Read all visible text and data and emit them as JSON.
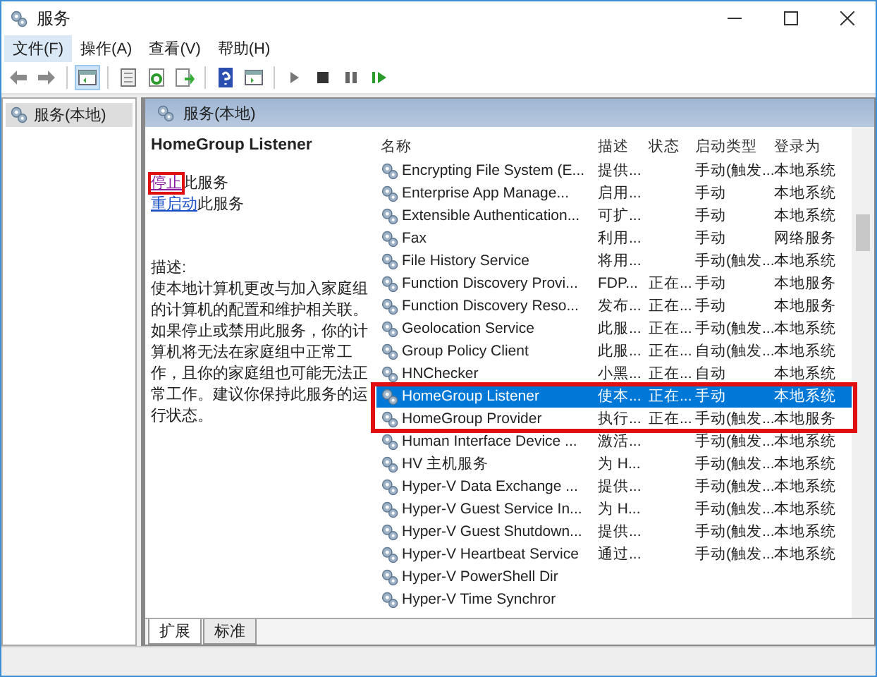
{
  "window": {
    "title": "服务"
  },
  "menu": [
    {
      "label": "文件(F)",
      "selected": true
    },
    {
      "label": "操作(A)",
      "selected": false
    },
    {
      "label": "查看(V)",
      "selected": false
    },
    {
      "label": "帮助(H)",
      "selected": false
    }
  ],
  "tree": {
    "items": [
      {
        "label": "服务(本地)",
        "selected": true
      }
    ]
  },
  "pane_header": "服务(本地)",
  "details": {
    "title": "HomeGroup Listener",
    "actions": [
      {
        "link": "停止",
        "text": "此服务",
        "outlined": true
      },
      {
        "link": "重启动",
        "text": "此服务",
        "outlined": false
      }
    ],
    "description_label": "描述:",
    "description": "使本地计算机更改与加入家庭组的计算机的配置和维护相关联。如果停止或禁用此服务，你的计算机将无法在家庭组中正常工作，且你的家庭组也可能无法正常工作。建议你保持此服务的运行状态。"
  },
  "table": {
    "columns": [
      "名称",
      "描述",
      "状态",
      "启动类型",
      "登录为"
    ],
    "rows": [
      {
        "name": "Encrypting File System (E...",
        "description": "提供...",
        "startup": "手动(触发...",
        "logon": "本地系统",
        "selected": false,
        "outlined": false
      },
      {
        "name": "Enterprise App Manage...",
        "description": "启用...",
        "startup": "手动",
        "logon": "本地系统",
        "selected": false,
        "outlined": false
      },
      {
        "name": "Extensible Authentication...",
        "description": "可扩...",
        "startup": "手动",
        "logon": "本地系统",
        "selected": false,
        "outlined": false
      },
      {
        "name": "Fax",
        "description": "利用...",
        "startup": "手动",
        "logon": "网络服务",
        "selected": false,
        "outlined": false
      },
      {
        "name": "File History Service",
        "description": "将用...",
        "startup": "手动(触发...",
        "logon": "本地系统",
        "selected": false,
        "outlined": false
      },
      {
        "name": "Function Discovery Provi...",
        "description": "FDP...",
        "status": "正在...",
        "startup": "手动",
        "logon": "本地服务",
        "selected": false,
        "outlined": false
      },
      {
        "name": "Function Discovery Reso...",
        "description": "发布...",
        "status": "正在...",
        "startup": "手动",
        "logon": "本地服务",
        "selected": false,
        "outlined": false
      },
      {
        "name": "Geolocation Service",
        "description": "此服...",
        "status": "正在...",
        "startup": "手动(触发...",
        "logon": "本地系统",
        "selected": false,
        "outlined": false
      },
      {
        "name": "Group Policy Client",
        "description": "此服...",
        "status": "正在...",
        "startup": "自动(触发...",
        "logon": "本地系统",
        "selected": false,
        "outlined": false
      },
      {
        "name": "HNChecker",
        "description": "小黑...",
        "status": "正在...",
        "startup": "自动",
        "logon": "本地系统",
        "selected": false,
        "outlined": false
      },
      {
        "name": "HomeGroup Listener",
        "description": "使本...",
        "status": "正在...",
        "startup": "手动",
        "logon": "本地系统",
        "selected": true,
        "outlined": true
      },
      {
        "name": "HomeGroup Provider",
        "description": "执行...",
        "status": "正在...",
        "startup": "手动(触发...",
        "logon": "本地服务",
        "selected": false,
        "outlined": true
      },
      {
        "name": "Human Interface Device ...",
        "description": "激活...",
        "startup": "手动(触发...",
        "logon": "本地系统",
        "selected": false,
        "outlined": false
      },
      {
        "name": "HV 主机服务",
        "description": "为 H...",
        "startup": "手动(触发...",
        "logon": "本地系统",
        "selected": false,
        "outlined": false
      },
      {
        "name": "Hyper-V Data Exchange ...",
        "description": "提供...",
        "startup": "手动(触发...",
        "logon": "本地系统",
        "selected": false,
        "outlined": false
      },
      {
        "name": "Hyper-V Guest Service In...",
        "description": "为 H...",
        "startup": "手动(触发...",
        "logon": "本地系统",
        "selected": false,
        "outlined": false
      },
      {
        "name": "Hyper-V Guest Shutdown...",
        "description": "提供...",
        "startup": "手动(触发...",
        "logon": "本地系统",
        "selected": false,
        "outlined": false
      },
      {
        "name": "Hyper-V Heartbeat Service",
        "description": "通过...",
        "startup": "手动(触发...",
        "logon": "本地系统",
        "selected": false,
        "outlined": false
      },
      {
        "name": "Hyper-V PowerShell Dir",
        "selected": false,
        "outlined": false
      },
      {
        "name": "Hyper-V Time Synchror",
        "selected": false,
        "outlined": false
      }
    ]
  },
  "bottom_tabs": [
    {
      "label": "扩展",
      "selected": true
    },
    {
      "label": "标准",
      "selected": false
    }
  ]
}
